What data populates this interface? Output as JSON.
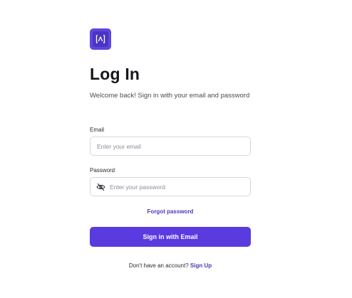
{
  "colors": {
    "brand": "#5a3be0",
    "link": "#4a3ab8",
    "text_primary": "#17161c",
    "text_secondary": "#4b4a55",
    "placeholder": "#8c8b96",
    "input_border": "#d7d6de"
  },
  "logo": {
    "icon": "caret-bracket-logo-icon"
  },
  "title": "Log In",
  "subtitle": "Welcome back! Sign in with your email and password",
  "form": {
    "email": {
      "label": "Email",
      "placeholder": "Enter your email",
      "value": ""
    },
    "password": {
      "label": "Password",
      "placeholder": "Enter your password",
      "value": "",
      "toggle_icon": "eye-off-icon"
    },
    "forgot_link": "Forgot password",
    "submit_label": "Sign in with Email"
  },
  "footer": {
    "prompt": "Don't have an account?",
    "signup_link": "Sign Up"
  }
}
